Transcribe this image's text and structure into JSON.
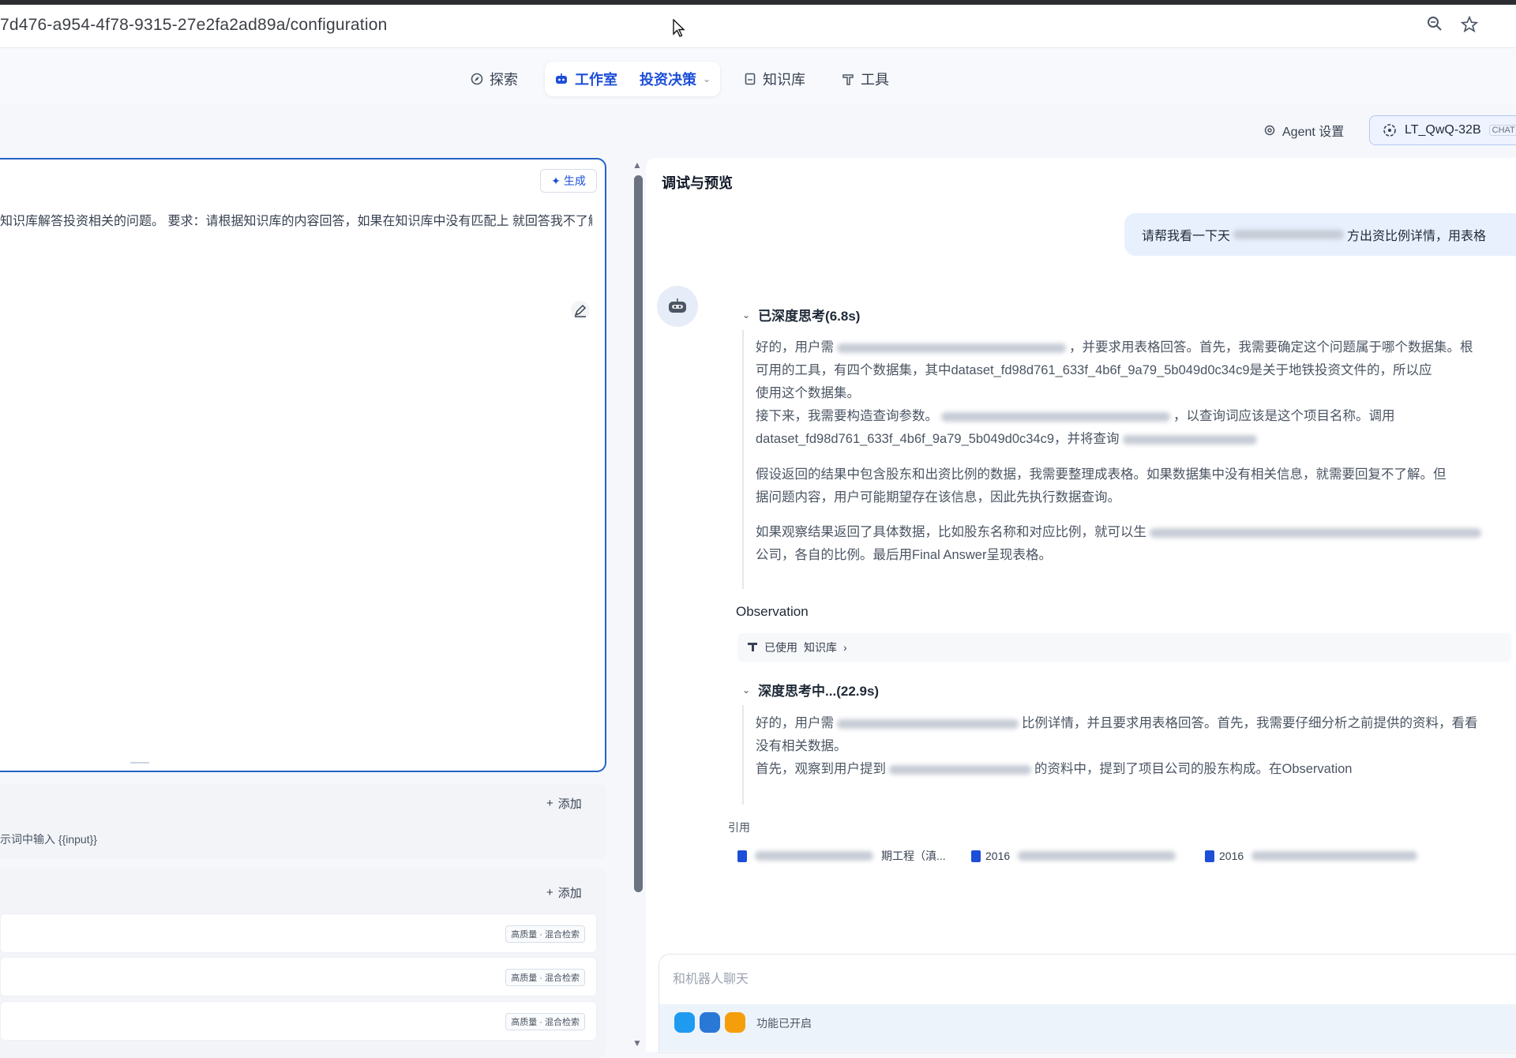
{
  "browser": {
    "url": "7d476-a954-4f78-9315-27e2fa2ad89a/configuration"
  },
  "nav": {
    "explore": "探索",
    "studio": "工作室",
    "app_name": "投资决策",
    "knowledge": "知识库",
    "tools": "工具"
  },
  "header": {
    "agent_settings": "Agent 设置",
    "model_name": "LT_QwQ-32B",
    "model_tag": "CHAT"
  },
  "prompt": {
    "generate_label": "生成",
    "text": "知识库解答投资相关的问题。 要求：请根据知识库的内容回答，如果在知识库中没有匹配上 就回答我不了解"
  },
  "variables": {
    "add_label": "添加",
    "hint": "示词中输入 {{input}}"
  },
  "knowledge": {
    "add_label": "添加",
    "rows": [
      {
        "tag": "高质量 · 混合检索"
      },
      {
        "tag": "高质量 · 混合检索"
      },
      {
        "tag": "高质量 · 混合检索"
      }
    ]
  },
  "preview": {
    "title": "调试与预览",
    "user_message_prefix": "请帮我看一下天",
    "user_message_suffix": "方出资比例详情，用表格",
    "thinking1": {
      "label": "已深度思考(6.8s)",
      "p1_l1_a": "好的，用户需",
      "p1_l1_b": "，并要求用表格回答。首先，我需要确定这个问题属于哪个数据集。根",
      "p1_l2": "可用的工具，有四个数据集，其中dataset_fd98d761_633f_4b6f_9a79_5b049d0c34c9是关于地铁投资文件的，所以应",
      "p1_l3": "使用这个数据集。",
      "p1_l4_a": "接下来，我需要构造查询参数。",
      "p1_l4_b": "，以查询词应该是这个项目名称。调用",
      "p1_l5": "dataset_fd98d761_633f_4b6f_9a79_5b049d0c34c9，并将查询",
      "p2_l1": "假设返回的结果中包含股东和出资比例的数据，我需要整理成表格。如果数据集中没有相关信息，就需要回复不了解。但",
      "p2_l2": "据问题内容，用户可能期望存在该信息，因此先执行数据查询。",
      "p3_l1": "如果观察结果返回了具体数据，比如股东名称和对应比例，就可以生",
      "p3_l2": "公司，各自的比例。最后用Final Answer呈现表格。"
    },
    "observation_label": "Observation",
    "used_kb_prefix": "已使用",
    "used_kb_name": "知识库",
    "thinking2": {
      "label": "深度思考中...(22.9s)",
      "l1_a": "好的，用户需",
      "l1_b": "比例详情，并且要求用表格回答。首先，我需要仔细分析之前提供的资料，看看",
      "l2": "没有相关数据。",
      "l3_a": "首先，观察到用户提到",
      "l3_b": "的资料中，提到了项目公司的股东构成。在Observation"
    },
    "cite_label": "引用",
    "citations": [
      {
        "text": "期工程（滇..."
      },
      {
        "text": "2016"
      },
      {
        "text": "2016"
      }
    ],
    "chat_placeholder": "和机器人聊天",
    "features_enabled": "功能已开启"
  }
}
